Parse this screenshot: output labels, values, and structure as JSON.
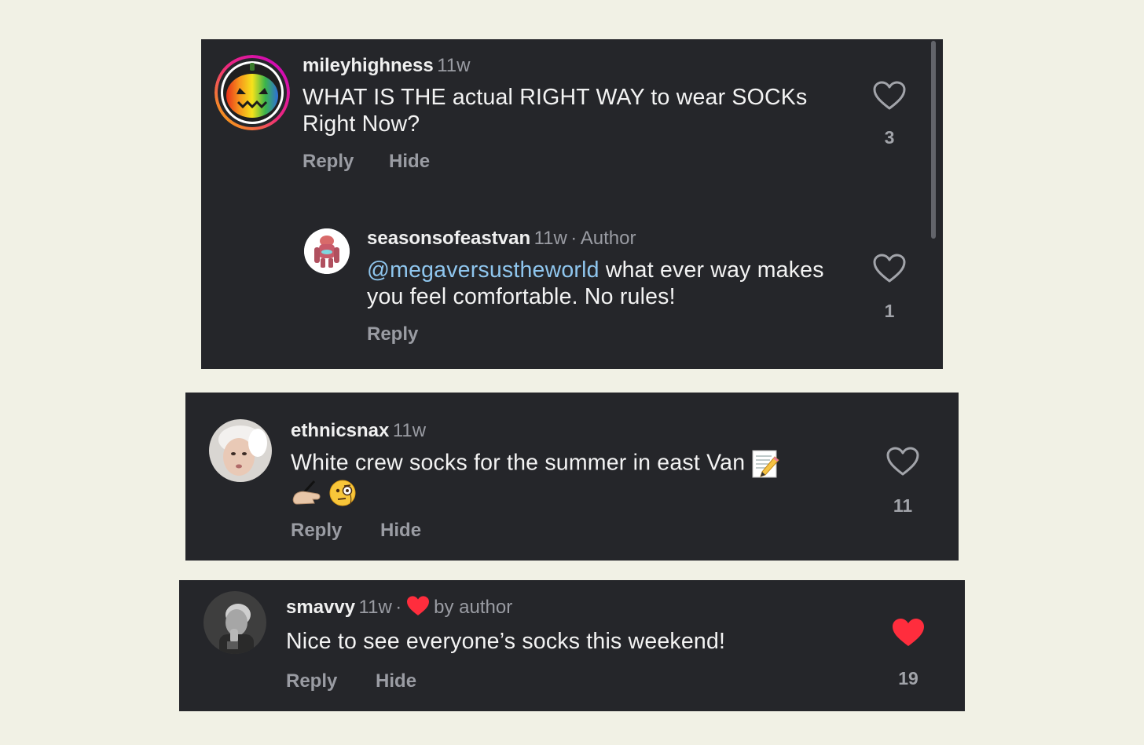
{
  "comments": [
    {
      "username": "mileyhighness",
      "time": "11w",
      "text": "WHAT IS THE actual RIGHT WAY to wear SOCKs Right Now?",
      "actions": {
        "reply": "Reply",
        "hide": "Hide"
      },
      "likes": "3",
      "reply": {
        "username": "seasonsofeastvan",
        "time": "11w",
        "separator": "·",
        "badge": "Author",
        "mention": "@megaversustheworld",
        "text": " what ever way makes you feel comfortable. No rules!",
        "actions": {
          "reply": "Reply"
        },
        "likes": "1"
      }
    },
    {
      "username": "ethnicsnax",
      "time": "11w",
      "text": "White crew socks for the summer in east Van",
      "emojis": [
        "memo-emoji",
        "writing-hand-emoji",
        "face-with-monocle-emoji"
      ],
      "actions": {
        "reply": "Reply",
        "hide": "Hide"
      },
      "likes": "11"
    },
    {
      "username": "smavvy",
      "time": "11w",
      "separator": "·",
      "liked_by": "by author",
      "text": "Nice to see everyone’s socks this weekend!",
      "actions": {
        "reply": "Reply",
        "hide": "Hide"
      },
      "likes": "19",
      "liked": true
    }
  ],
  "colors": {
    "page_bg": "#f1f1e5",
    "card_bg": "#25262a",
    "mention": "#8fc6ee",
    "like_red": "#ff2d3d",
    "muted": "#9a9ca3"
  }
}
